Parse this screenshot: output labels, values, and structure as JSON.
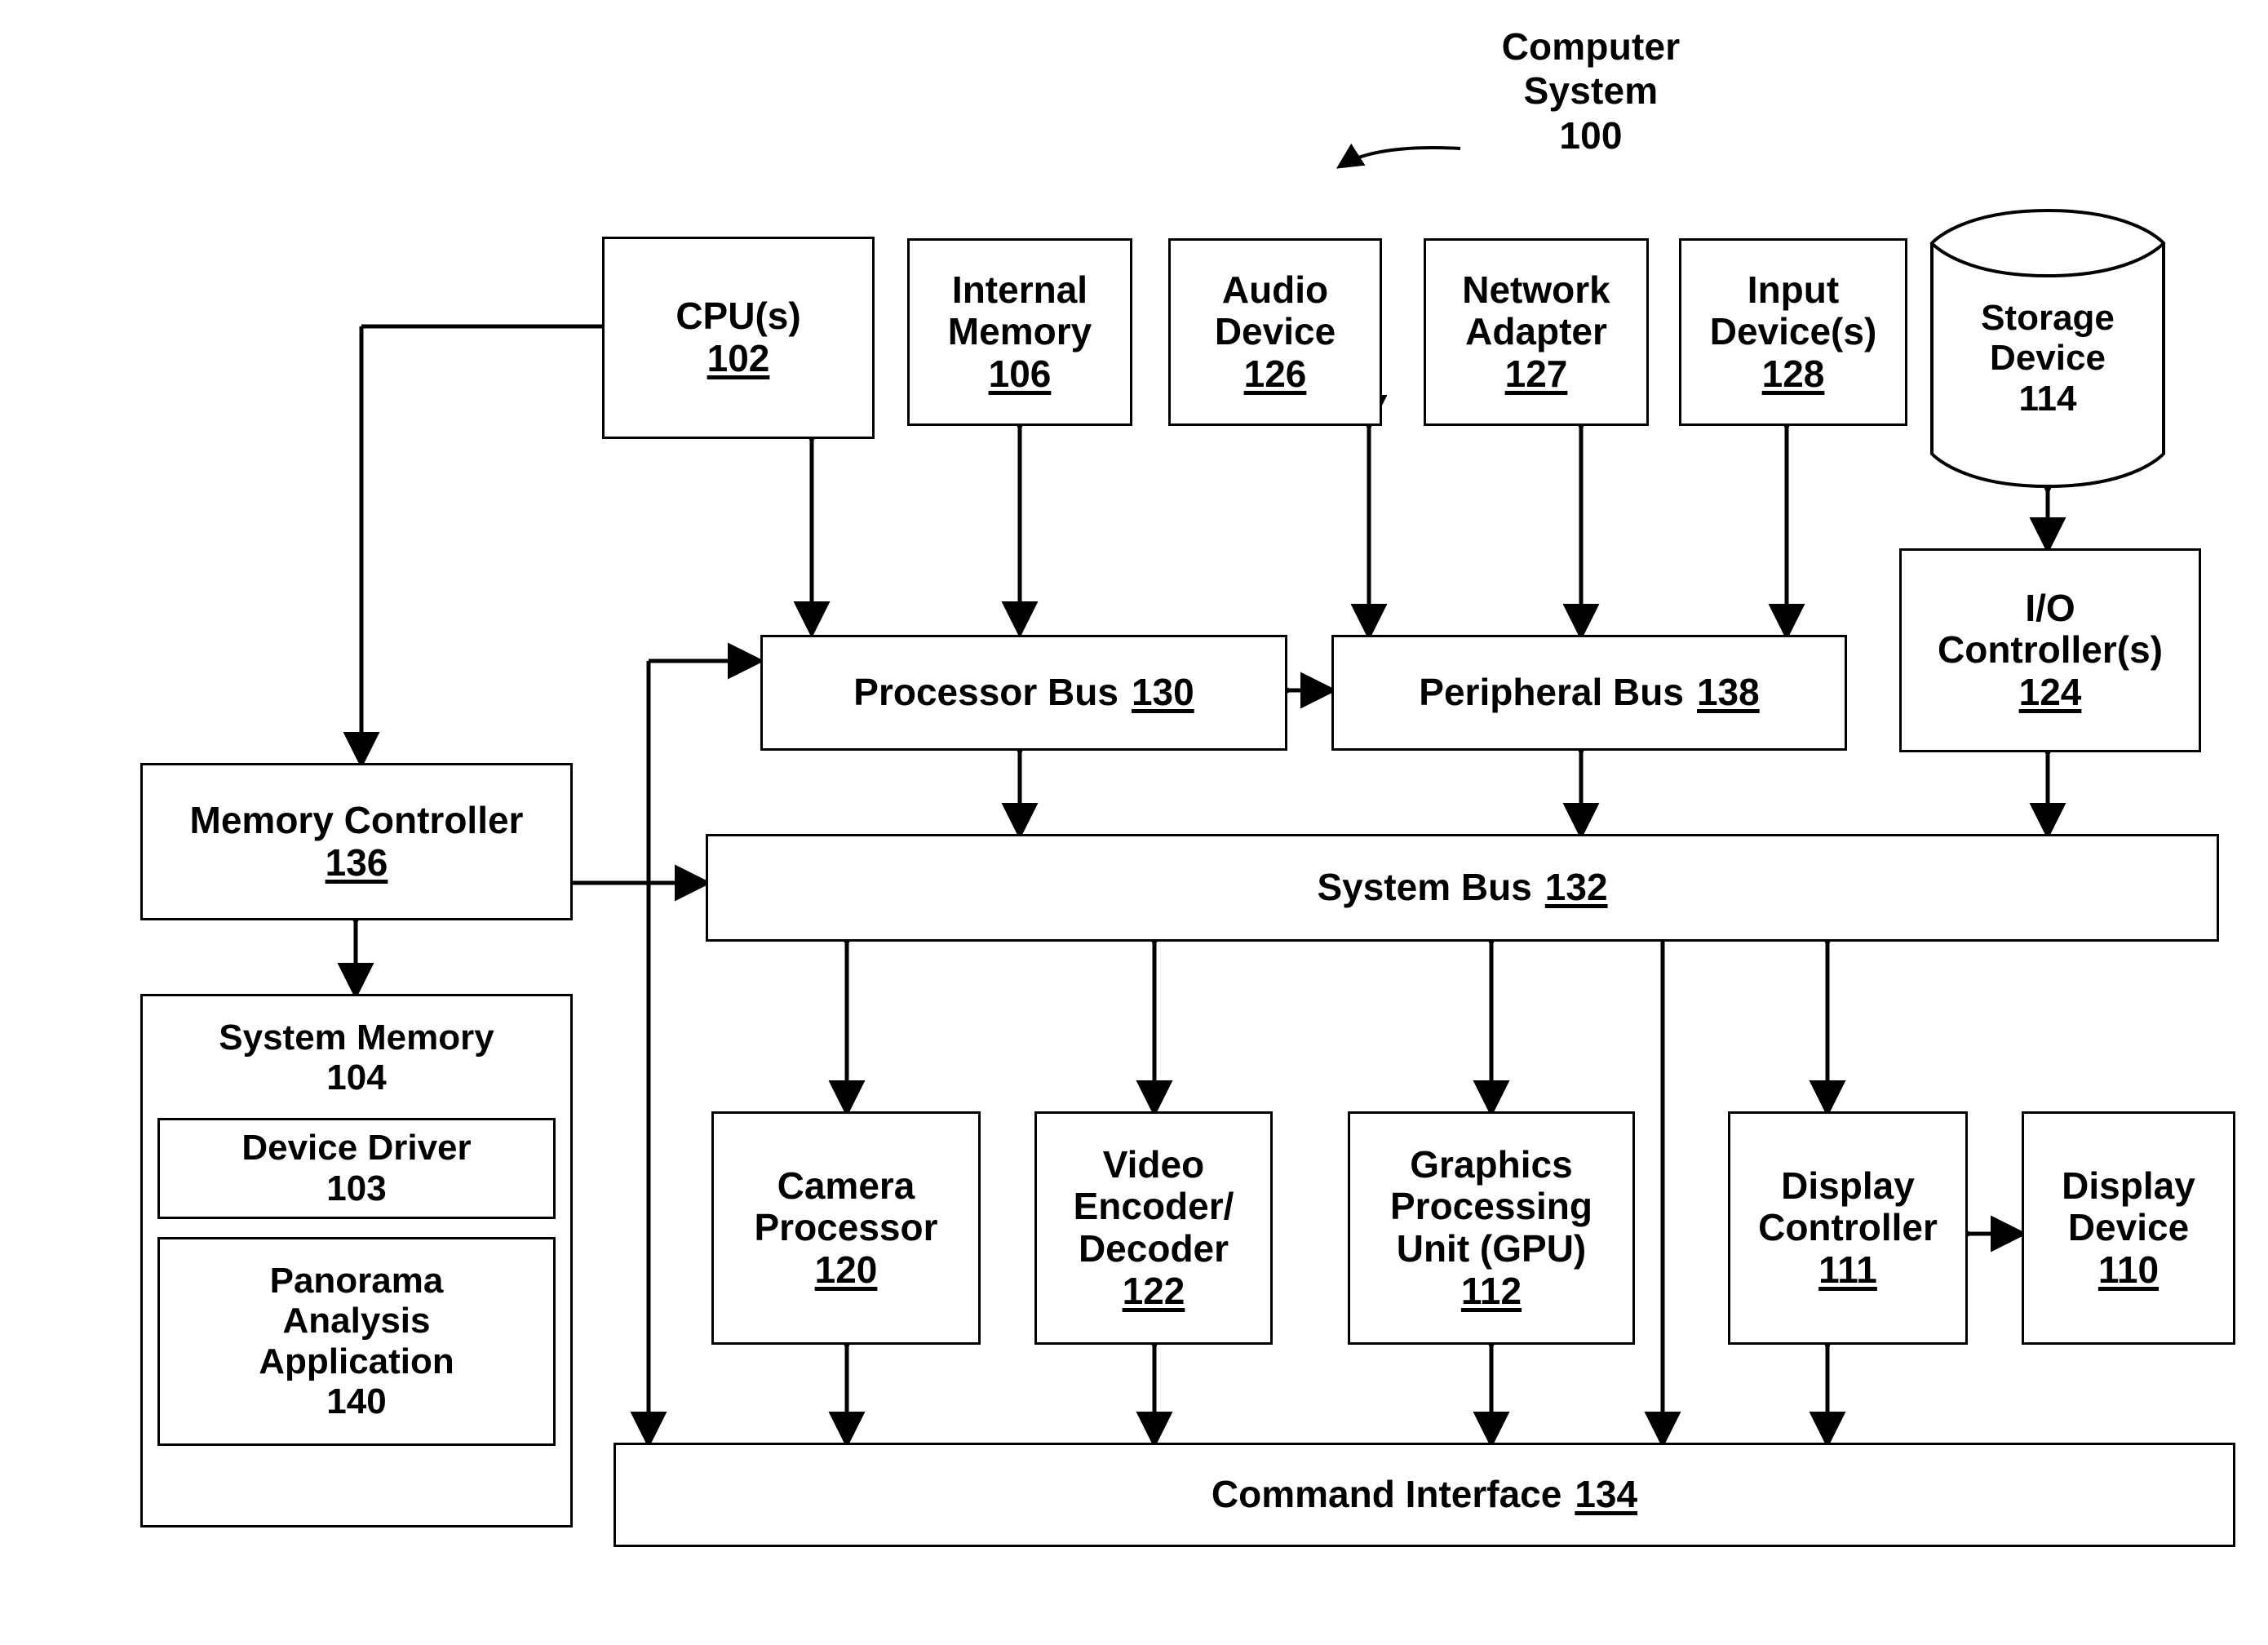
{
  "figure": {
    "title_lines": [
      "Computer",
      "System"
    ],
    "title_number": "100",
    "callout_icon": "curved-arrow-icon"
  },
  "blocks": {
    "cpu": {
      "title": "CPU(s)",
      "number": "102"
    },
    "internal_memory": {
      "title": "Internal\nMemory",
      "line1": "Internal",
      "line2": "Memory",
      "number": "106"
    },
    "audio_device": {
      "line1": "Audio",
      "line2": "Device",
      "number": "126"
    },
    "network_adapter": {
      "line1": "Network",
      "line2": "Adapter",
      "number": "127"
    },
    "input_devices": {
      "line1": "Input",
      "line2": "Device(s)",
      "number": "128"
    },
    "storage_device": {
      "line1": "Storage",
      "line2": "Device",
      "number": "114"
    },
    "io_controller": {
      "line1": "I/O",
      "line2": "Controller(s)",
      "number": "124"
    },
    "processor_bus": {
      "title": "Processor Bus",
      "number": "130"
    },
    "peripheral_bus": {
      "title": "Peripheral Bus",
      "number": "138"
    },
    "system_bus": {
      "title": "System Bus",
      "number": "132"
    },
    "command_interface": {
      "title": "Command Interface",
      "number": "134"
    },
    "memory_controller": {
      "title": "Memory Controller",
      "number": "136"
    },
    "system_memory": {
      "title": "System Memory",
      "number": "104"
    },
    "device_driver": {
      "title": "Device Driver",
      "number": "103"
    },
    "panorama_app": {
      "line1": "Panorama",
      "line2": "Analysis",
      "line3": "Application",
      "number": "140"
    },
    "camera_processor": {
      "line1": "Camera",
      "line2": "Processor",
      "number": "120"
    },
    "video_codec": {
      "line1": "Video",
      "line2": "Encoder/",
      "line3": "Decoder",
      "number": "122"
    },
    "gpu": {
      "line1": "Graphics",
      "line2": "Processing",
      "line3": "Unit (GPU)",
      "number": "112"
    },
    "display_controller": {
      "line1": "Display",
      "line2": "Controller",
      "number": "111"
    },
    "display_device": {
      "line1": "Display",
      "line2": "Device",
      "number": "110"
    }
  },
  "colors": {
    "stroke": "#000000",
    "background": "#ffffff"
  }
}
